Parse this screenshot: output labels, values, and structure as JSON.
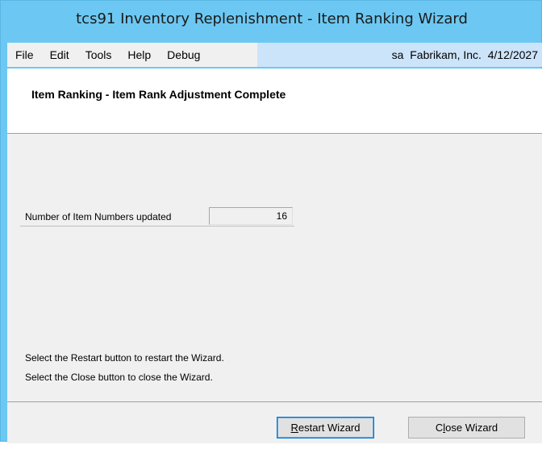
{
  "window": {
    "title": "tcs91 Inventory Replenishment - Item Ranking Wizard"
  },
  "menubar": {
    "items": [
      "File",
      "Edit",
      "Tools",
      "Help",
      "Debug"
    ],
    "status": "sa  Fabrikam, Inc.  4/12/2027"
  },
  "header": {
    "title": "Item Ranking - Item Rank Adjustment Complete"
  },
  "form": {
    "items_updated_label": "Number of Item Numbers updated",
    "items_updated_value": "16"
  },
  "instructions": {
    "line1": "Select the Restart button to restart the Wizard.",
    "line2": "Select the Close button to close the Wizard."
  },
  "buttons": {
    "restart": {
      "mnemonic": "R",
      "rest": "estart Wizard"
    },
    "close": {
      "pre": "C",
      "mnemonic": "l",
      "rest": "ose Wizard"
    }
  },
  "colors": {
    "titlebar": "#6cc8f2",
    "menu_status_fill": "#cce4fa",
    "panel": "#f0f0f0"
  }
}
